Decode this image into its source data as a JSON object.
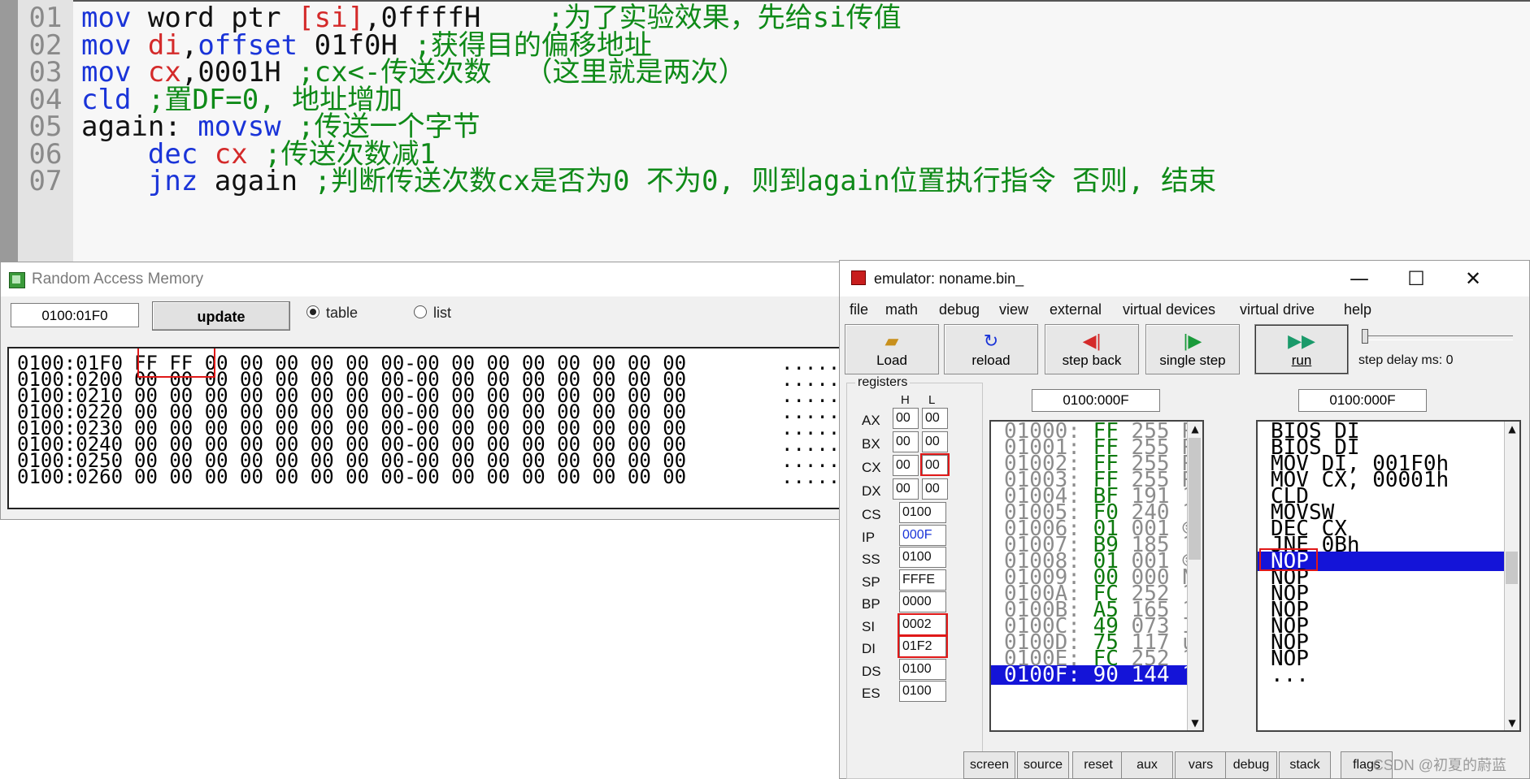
{
  "code": {
    "lines": [
      {
        "n": "01",
        "parts": [
          [
            "kw",
            "mov "
          ],
          [
            "pl",
            "word ptr "
          ],
          [
            "reg",
            "[si]"
          ],
          [
            "pl",
            ","
          ],
          [
            "num",
            "0ffffH"
          ],
          [
            "cm",
            "    ;为了实验效果，先给si传值"
          ]
        ]
      },
      {
        "n": "02",
        "parts": [
          [
            "kw",
            "mov "
          ],
          [
            "reg",
            "di"
          ],
          [
            "pl",
            ","
          ],
          [
            "kw",
            "offset "
          ],
          [
            "num",
            "01f0H "
          ],
          [
            "cm",
            ";获得目的偏移地址"
          ]
        ]
      },
      {
        "n": "03",
        "parts": [
          [
            "kw",
            "mov "
          ],
          [
            "reg",
            "cx"
          ],
          [
            "pl",
            ","
          ],
          [
            "num",
            "0001H "
          ],
          [
            "cm",
            ";cx<-传送次数  （这里就是两次）"
          ]
        ]
      },
      {
        "n": "04",
        "parts": [
          [
            "kw",
            "cld "
          ],
          [
            "cm",
            ";置DF=0, 地址增加"
          ]
        ]
      },
      {
        "n": "05",
        "parts": [
          [
            "pl",
            "again: "
          ],
          [
            "kw",
            "movsw "
          ],
          [
            "cm",
            ";传送一个字节"
          ]
        ]
      },
      {
        "n": "06",
        "parts": [
          [
            "pl",
            "    "
          ],
          [
            "kw",
            "dec "
          ],
          [
            "reg",
            "cx "
          ],
          [
            "cm",
            ";传送次数减1"
          ]
        ]
      },
      {
        "n": "07",
        "parts": [
          [
            "pl",
            "    "
          ],
          [
            "kw",
            "jnz "
          ],
          [
            "pl",
            "again "
          ],
          [
            "cm",
            ";判断传送次数cx是否为0 不为0, 则到again位置执行指令 否则, 结束"
          ]
        ]
      }
    ]
  },
  "ram": {
    "title": "Random Access Memory",
    "address": "0100:01F0",
    "update_label": "update",
    "view_table": "table",
    "view_list": "list",
    "rows": [
      {
        "addr": "0100:01F0",
        "bytes": "FF FF 00 00 00 00 00 00-00 00 00 00 00 00 00 00",
        "ascii": "........"
      },
      {
        "addr": "0100:0200",
        "bytes": "00 00 00 00 00 00 00 00-00 00 00 00 00 00 00 00",
        "ascii": "........"
      },
      {
        "addr": "0100:0210",
        "bytes": "00 00 00 00 00 00 00 00-00 00 00 00 00 00 00 00",
        "ascii": "........"
      },
      {
        "addr": "0100:0220",
        "bytes": "00 00 00 00 00 00 00 00-00 00 00 00 00 00 00 00",
        "ascii": "........"
      },
      {
        "addr": "0100:0230",
        "bytes": "00 00 00 00 00 00 00 00-00 00 00 00 00 00 00 00",
        "ascii": "........"
      },
      {
        "addr": "0100:0240",
        "bytes": "00 00 00 00 00 00 00 00-00 00 00 00 00 00 00 00",
        "ascii": "........"
      },
      {
        "addr": "0100:0250",
        "bytes": "00 00 00 00 00 00 00 00-00 00 00 00 00 00 00 00",
        "ascii": "........"
      },
      {
        "addr": "0100:0260",
        "bytes": "00 00 00 00 00 00 00 00-00 00 00 00 00 00 00 00",
        "ascii": "........"
      }
    ]
  },
  "emu": {
    "title": "emulator: noname.bin_",
    "window_buttons": {
      "min": "—",
      "max": "☐",
      "close": "✕"
    },
    "menu": [
      "file",
      "math",
      "debug",
      "view",
      "external",
      "virtual devices",
      "virtual drive",
      "help"
    ],
    "toolbar": {
      "load": "Load",
      "reload": "reload",
      "step_back": "step back",
      "single_step": "single step",
      "run": "run"
    },
    "step_delay": "step delay ms: 0",
    "registers_label": "registers",
    "h": "H",
    "l": "L",
    "regs_hl": [
      {
        "name": "AX",
        "h": "00",
        "l": "00"
      },
      {
        "name": "BX",
        "h": "00",
        "l": "00"
      },
      {
        "name": "CX",
        "h": "00",
        "l": "00"
      },
      {
        "name": "DX",
        "h": "00",
        "l": "00"
      }
    ],
    "regs": [
      {
        "name": "CS",
        "v": "0100"
      },
      {
        "name": "IP",
        "v": "000F"
      },
      {
        "name": "SS",
        "v": "0100"
      },
      {
        "name": "SP",
        "v": "FFFE"
      },
      {
        "name": "BP",
        "v": "0000"
      },
      {
        "name": "SI",
        "v": "0002"
      },
      {
        "name": "DI",
        "v": "01F2"
      },
      {
        "name": "DS",
        "v": "0100"
      },
      {
        "name": "ES",
        "v": "0100"
      }
    ],
    "ip_color": "#1a34d8",
    "mem_address": "0100:000F",
    "dis_address": "0100:000F",
    "memory": [
      {
        "a": "01000:",
        "h": "FF",
        "d": "255",
        "c": "RI"
      },
      {
        "a": "01001:",
        "h": "FF",
        "d": "255",
        "c": "RI"
      },
      {
        "a": "01002:",
        "h": "FF",
        "d": "255",
        "c": "RI"
      },
      {
        "a": "01003:",
        "h": "FF",
        "d": "255",
        "c": "RI"
      },
      {
        "a": "01004:",
        "h": "BF",
        "d": "191",
        "c": "?"
      },
      {
        "a": "01005:",
        "h": "F0",
        "d": "240",
        "c": "?"
      },
      {
        "a": "01006:",
        "h": "01",
        "d": "001",
        "c": "☺"
      },
      {
        "a": "01007:",
        "h": "B9",
        "d": "185",
        "c": "?"
      },
      {
        "a": "01008:",
        "h": "01",
        "d": "001",
        "c": "☺"
      },
      {
        "a": "01009:",
        "h": "00",
        "d": "000",
        "c": "NU"
      },
      {
        "a": "0100A:",
        "h": "FC",
        "d": "252",
        "c": "?"
      },
      {
        "a": "0100B:",
        "h": "A5",
        "d": "165",
        "c": "?"
      },
      {
        "a": "0100C:",
        "h": "49",
        "d": "073",
        "c": "I"
      },
      {
        "a": "0100D:",
        "h": "75",
        "d": "117",
        "c": "u"
      },
      {
        "a": "0100E:",
        "h": "FC",
        "d": "252",
        "c": "?"
      },
      {
        "a": "0100F:",
        "h": "90",
        "d": "144",
        "c": "?"
      }
    ],
    "disasm": [
      "BIOS DI",
      "BIOS DI",
      "MOV DI, 001F0h",
      "MOV CX, 00001h",
      "CLD",
      "MOVSW",
      "DEC CX",
      "JNE 0Bh",
      "NOP",
      "NOP",
      "NOP",
      "NOP",
      "NOP",
      "NOP",
      "NOP",
      "..."
    ],
    "bottom": [
      "screen",
      "source",
      "reset",
      "aux",
      "vars",
      "debug",
      "stack",
      "flags"
    ]
  },
  "watermark": "CSDN @初夏的蔚蓝",
  "colors": {
    "selection": "#1414d8",
    "highlight_box": "#e01818",
    "comment": "#0f8a18",
    "keyword": "#1a34d8",
    "register": "#d42a2a"
  }
}
